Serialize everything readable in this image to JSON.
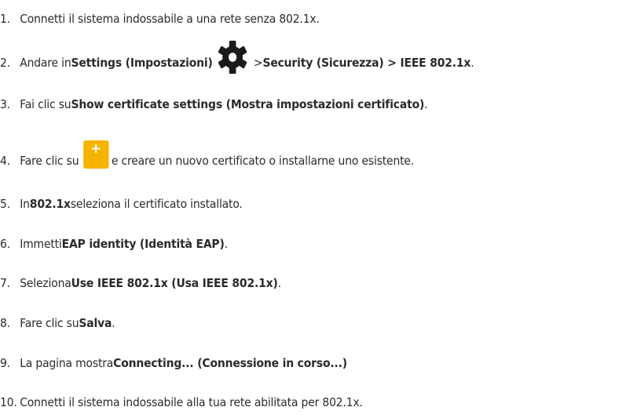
{
  "steps": [
    {
      "num": "1.",
      "text": "Connetti il sistema indossabile a una rete senza 802.1x."
    },
    {
      "num": "2.",
      "pre": "Andare in ",
      "bold1": "Settings (Impostazioni)",
      "mid": " > ",
      "bold2": "Security (Sicurezza) > IEEE 802.1x",
      "post": ".",
      "icon": "gear-icon"
    },
    {
      "num": "3.",
      "pre": "Fai clic su ",
      "bold1": "Show certificate settings (Mostra impostazioni certificato)",
      "post": "."
    },
    {
      "num": "4.",
      "pre": "Fare clic su ",
      "post": " e creare un nuovo certificato o installarne uno esistente.",
      "icon": "add-plus-icon",
      "icon_glyph": "+"
    },
    {
      "num": "5.",
      "pre": "In ",
      "bold1": "802.1x",
      "post": " seleziona il certificato installato."
    },
    {
      "num": "6.",
      "pre": "Immetti ",
      "bold1": "EAP identity (Identità EAP)",
      "post": "."
    },
    {
      "num": "7.",
      "pre": "Seleziona ",
      "bold1": "Use IEEE 802.1x (Usa IEEE 802.1x)",
      "post": "."
    },
    {
      "num": "8.",
      "pre": "Fare clic su ",
      "bold1": "Salva",
      "post": "."
    },
    {
      "num": "9.",
      "pre": "La pagina mostra ",
      "bold1": "Connecting... (Connessione in corso...)"
    },
    {
      "num": "10.",
      "text": "Connetti il sistema indossabile alla tua rete abilitata per 802.1x."
    }
  ],
  "colors": {
    "text": "#2b2b2b",
    "gear": "#1a1a1a",
    "plus_tile": "#f5b400",
    "plus_glyph": "#ffffff"
  }
}
